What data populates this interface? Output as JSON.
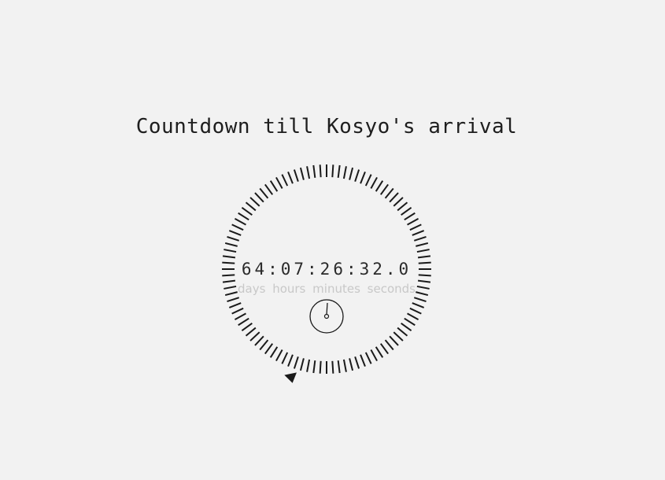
{
  "page": {
    "title": "Countdown till Kosyo's arrival"
  },
  "countdown": {
    "display": "64:07:26:32.0",
    "days": "64",
    "hours": "07",
    "minutes": "26",
    "seconds": "32.0",
    "units": {
      "days": "days",
      "hours": "hours",
      "minutes": "minutes",
      "seconds": "seconds"
    }
  },
  "dial": {
    "tick_count": 100,
    "progress_marker_fraction": 0.55,
    "icons": [
      "clock-icon",
      "pointer-marker-icon"
    ]
  },
  "colors": {
    "background": "#f2f2f2",
    "ink": "#1a1a1a",
    "muted": "#c8c8c8"
  }
}
